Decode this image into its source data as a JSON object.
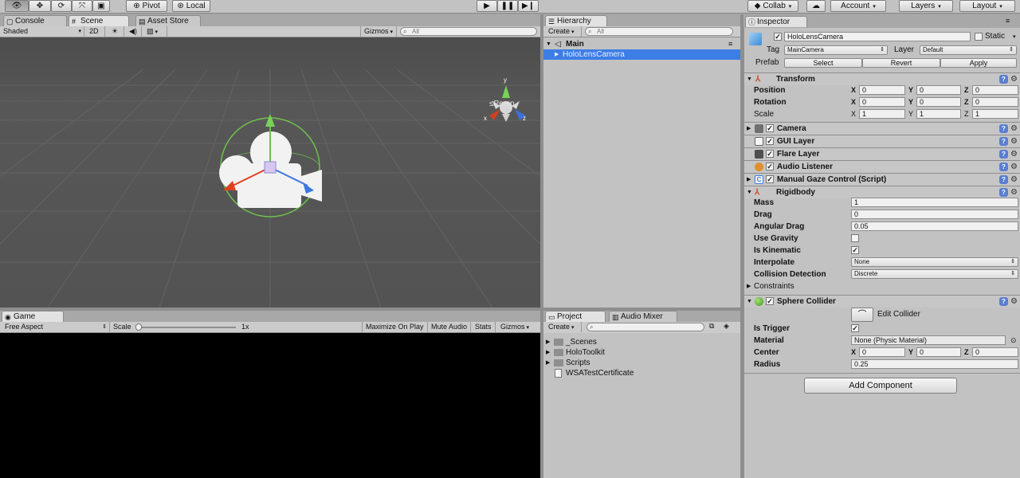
{
  "toolbar": {
    "tools": [
      "view-tool",
      "move-tool",
      "rotate-tool",
      "scale-tool",
      "rect-tool"
    ],
    "pivot": "Pivot",
    "local": "Local",
    "collab": "Collab",
    "account": "Account",
    "layers": "Layers",
    "layout": "Layout"
  },
  "tabs": {
    "console": "Console",
    "scene": "Scene",
    "asset_store": "Asset Store",
    "hierarchy": "Hierarchy",
    "inspector": "Inspector",
    "game": "Game",
    "project": "Project",
    "audio_mixer": "Audio Mixer"
  },
  "scene_bar": {
    "shading": "Shaded",
    "mode_2d": "2D",
    "gizmos": "Gizmos",
    "search_placeholder": "All",
    "persp": "Persp"
  },
  "hierarchy": {
    "create": "Create",
    "search_placeholder": "All",
    "scene_name": "Main",
    "selected_object": "HoloLensCamera"
  },
  "game_bar": {
    "aspect": "Free Aspect",
    "scale_label": "Scale",
    "scale_value": "1x",
    "maximize": "Maximize On Play",
    "mute": "Mute Audio",
    "stats": "Stats",
    "gizmos": "Gizmos"
  },
  "project": {
    "create": "Create",
    "items": [
      {
        "name": "_Scenes",
        "type": "folder"
      },
      {
        "name": "HoloToolkit",
        "type": "folder"
      },
      {
        "name": "Scripts",
        "type": "folder"
      },
      {
        "name": "WSATestCertificate",
        "type": "file"
      }
    ]
  },
  "inspector": {
    "object_name": "HoloLensCamera",
    "static_label": "Static",
    "tag_label": "Tag",
    "tag_value": "MainCamera",
    "layer_label": "Layer",
    "layer_value": "Default",
    "prefab_label": "Prefab",
    "prefab_select": "Select",
    "prefab_revert": "Revert",
    "prefab_apply": "Apply",
    "transform": {
      "title": "Transform",
      "position_label": "Position",
      "rotation_label": "Rotation",
      "scale_label": "Scale",
      "position": [
        "0",
        "0",
        "0"
      ],
      "rotation": [
        "0",
        "0",
        "0"
      ],
      "scale": [
        "1",
        "1",
        "1"
      ]
    },
    "components": [
      "Camera",
      "GUI Layer",
      "Flare Layer",
      "Audio Listener",
      "Manual Gaze Control (Script)"
    ],
    "rigidbody": {
      "title": "Rigidbody",
      "mass_label": "Mass",
      "mass": "1",
      "drag_label": "Drag",
      "drag": "0",
      "angular_drag_label": "Angular Drag",
      "angular_drag": "0.05",
      "use_gravity_label": "Use Gravity",
      "use_gravity": false,
      "is_kinematic_label": "Is Kinematic",
      "is_kinematic": true,
      "interpolate_label": "Interpolate",
      "interpolate": "None",
      "collision_label": "Collision Detection",
      "collision": "Discrete",
      "constraints_label": "Constraints"
    },
    "sphere_collider": {
      "title": "Sphere Collider",
      "edit_label": "Edit Collider",
      "is_trigger_label": "Is Trigger",
      "is_trigger": true,
      "material_label": "Material",
      "material": "None (Physic Material)",
      "center_label": "Center",
      "center": [
        "0",
        "0",
        "0"
      ],
      "radius_label": "Radius",
      "radius": "0.25"
    },
    "add_component": "Add Component"
  },
  "axes": {
    "x": "X",
    "y": "Y",
    "z": "Z"
  },
  "colors": {
    "selection": "#3d7ee6",
    "panel_bg": "#c2c2c2",
    "scene_bg": "#555555",
    "help_icon": "#5a7ed1"
  }
}
